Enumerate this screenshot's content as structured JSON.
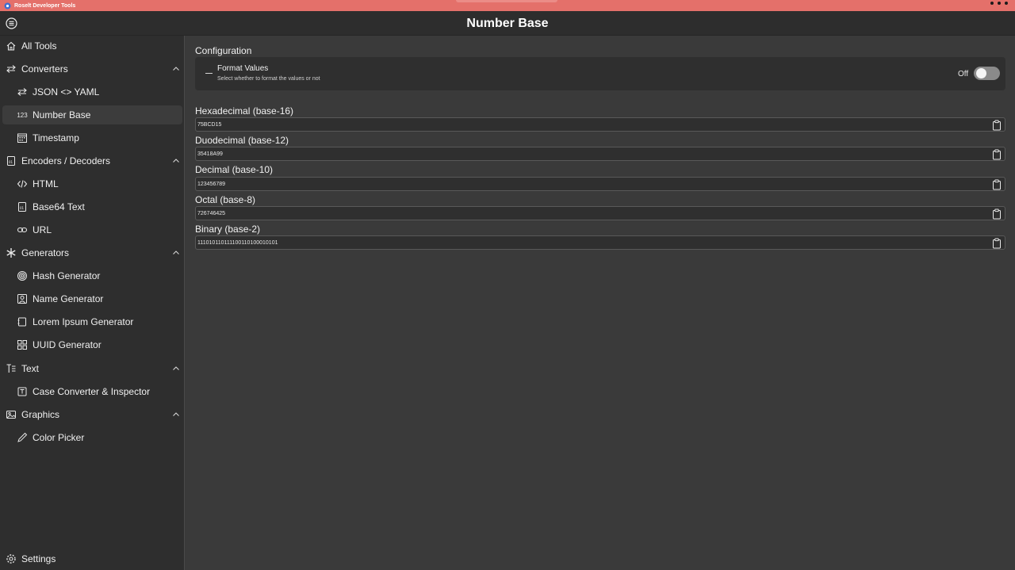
{
  "window": {
    "title": "Roselt Developer Tools"
  },
  "header": {
    "title": "Number Base"
  },
  "sidebar": {
    "all_tools": "All Tools",
    "converters": {
      "label": "Converters",
      "items": [
        "JSON <> YAML",
        "Number Base",
        "Timestamp"
      ]
    },
    "encoders": {
      "label": "Encoders / Decoders",
      "items": [
        "HTML",
        "Base64 Text",
        "URL"
      ]
    },
    "generators": {
      "label": "Generators",
      "items": [
        "Hash Generator",
        "Name Generator",
        "Lorem Ipsum Generator",
        "UUID Generator"
      ]
    },
    "text": {
      "label": "Text",
      "items": [
        "Case Converter & Inspector"
      ]
    },
    "graphics": {
      "label": "Graphics",
      "items": [
        "Color Picker"
      ]
    },
    "number_icon_text": "123",
    "settings": "Settings"
  },
  "config": {
    "label": "Configuration",
    "format_title": "Format Values",
    "format_desc": "Select whether to format the values or not",
    "toggle_state": "Off"
  },
  "fields": [
    {
      "label": "Hexadecimal (base-16)",
      "value": "75BCD15"
    },
    {
      "label": "Duodecimal (base-12)",
      "value": "35418A99"
    },
    {
      "label": "Decimal (base-10)",
      "value": "123456789"
    },
    {
      "label": "Octal (base-8)",
      "value": "726746425"
    },
    {
      "label": "Binary (base-2)",
      "value": "111010110111100110100010101"
    }
  ],
  "colors": {
    "accent_titlebar": "#e4706a",
    "background": "#3a3a3a",
    "sidebar": "#2e2e2e"
  }
}
